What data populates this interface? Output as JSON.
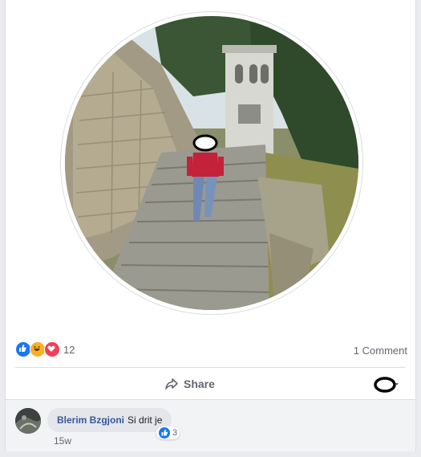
{
  "post": {
    "reactions": {
      "types": [
        "like-icon",
        "haha-icon",
        "love-icon"
      ],
      "count": "12"
    },
    "comment_count": "1 Comment",
    "actions": {
      "share_label": "Share"
    }
  },
  "comment": {
    "author": "Blerim Bzgjoni",
    "text": "Si drit je",
    "reaction_count": "3",
    "time": "15w"
  },
  "colors": {
    "like": "#1877f2",
    "haha": "#f7b125",
    "love": "#f33e58",
    "link": "#385898"
  }
}
